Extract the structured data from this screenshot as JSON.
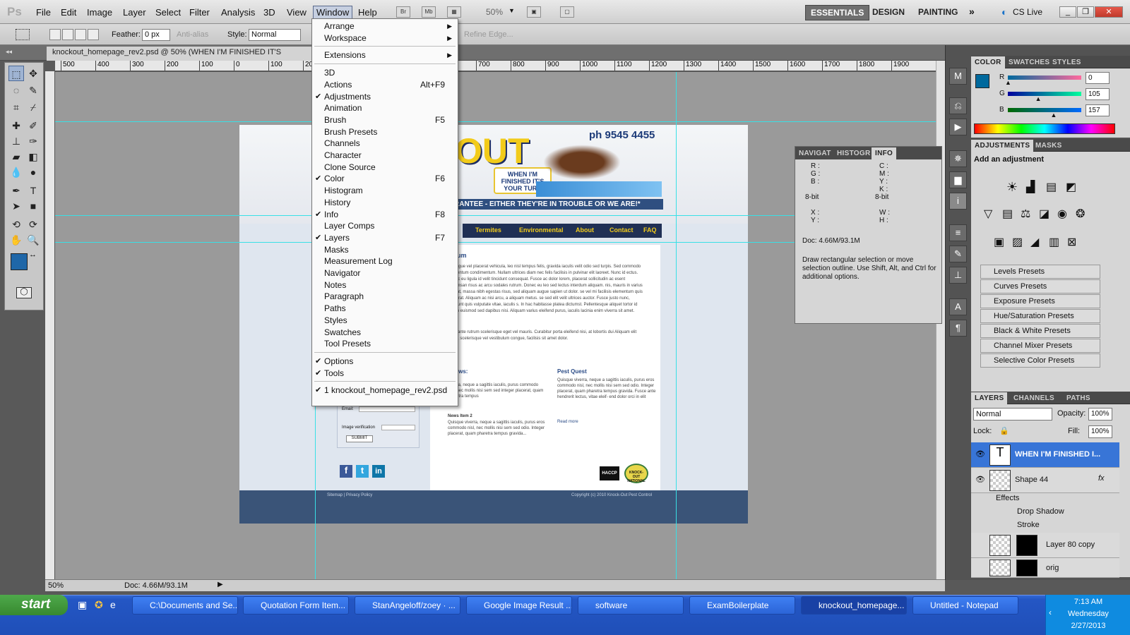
{
  "app": {
    "logo": "Ps"
  },
  "menubar": {
    "items": [
      "File",
      "Edit",
      "Image",
      "Layer",
      "Select",
      "Filter",
      "Analysis",
      "3D",
      "View",
      "Window",
      "Help"
    ],
    "bridge": "Br",
    "minibridge": "Mb",
    "zoom": "50%",
    "workspaces": [
      "ESSENTIALS",
      "DESIGN",
      "PAINTING"
    ],
    "cslive": "CS Live"
  },
  "options": {
    "feather_label": "Feather:",
    "feather_value": "0 px",
    "antialias": "Anti-alias",
    "style_label": "Style:",
    "style_value": "Normal",
    "refine_edge": "Refine Edge..."
  },
  "document": {
    "title": "knockout_homepage_rev2.psd @ 50% (WHEN I'M FINISHED IT'S",
    "zoom": "50%",
    "doc_size": "Doc: 4.66M/93.1M"
  },
  "ruler_ticks": [
    "500",
    "400",
    "300",
    "200",
    "100",
    "0",
    "100",
    "200",
    "300",
    "400",
    "500",
    "600",
    "700",
    "800",
    "900",
    "1000",
    "1100",
    "1200",
    "1300",
    "1400",
    "1500",
    "1600",
    "1700",
    "1800",
    "1900"
  ],
  "website": {
    "logo_text": "OUT",
    "phone": "ph 9545 4455",
    "tagline_box": "WHEN I'M FINISHED IT'S YOUR TURN",
    "guarantee": "RANTEE - EITHER THEY'RE IN TROUBLE OR WE ARE!*",
    "nav": [
      "Termites",
      "Environmental",
      "About",
      "Contact",
      "FAQ"
    ],
    "heading": "ipsum",
    "body": "m, augue vel placerat vehicula, leo nisl tempus felis, gravida iaculis velit odio sed turpis. Sed commodo elementum condimentum. Nullam ultrices diam nec felis facilisis in pulvinar elit laoreet. Nunc id ectus. Donec eu ligula id velit tincidunt consequat. Fusce ac dolor lorem, placerat sollicitudin ac esent accumsan risus ac arcu sodales rutrum. Donec eu leo sed lectus interdum aliquam. nis, mauris in varius feugiat, massa nibh egestas risus, sed aliquam augue sapien ut dolor. se vel mi facilisis elementum quis non erat. Aliquam ac nisi arcu, a aliquam metus. se sed elit velit ultrices auctor. Fusce justo nunc, tincidunt quis vulputate vitae, iaculis s. In hac habitasse platea dictumst. Pellentesque aliquet tortor id ipsum euismod sed dapibus nisi. Aliquam varius eleifend purus, iaculis lacinia enim viverra sit amet.",
    "body2": "lla in ante rutrum scelerisque eget vel mauris. Curabitur porta eleifend nisi, at lobortis dui Aliquam elit lacus, scelerisque vel vestibulum congue, facilisis sit amet dolor.",
    "news_title": "t News:",
    "news_item1_title": "n 1",
    "news_item1": "viverra, neque a sagittis iaculis, purus commodo nisl, nec mollis nisi sem sed integer placerat, quam pharetra tempus",
    "news_item2_title": "News Item 2",
    "news_item2": "Quisque viverra, neque a sagittis iaculis, purus eros commodo nisl, nec mollis nisi sem sed odio. Integer placerat, quam pharetra tempus gravida...",
    "pest_title": "Pest Quest",
    "pest_text": "Quisque viverra, neque a sagittis iaculis, purus eros commodo nisl, nec mollis nisi sem sed odio. Integer placerat, quam pharetra tempus gravida. Fusce ante hendrerit lectus, vitae eleif- end dolor orci in elit",
    "read_more": "Read more",
    "email_label": "Email:",
    "verify_label": "Image verification",
    "submit": "SUBMIT",
    "footer_links": "Sitemap | Privacy Policy",
    "copyright": "Copyright (c) 2010 Knock-Out Pest Control",
    "badge": "HACCP",
    "badge2": "KNOCK-OUT NATIONAL"
  },
  "window_menu": {
    "items": [
      {
        "label": "Arrange",
        "sub": true
      },
      {
        "label": "Workspace",
        "sub": true
      },
      {
        "sep": true
      },
      {
        "label": "Extensions",
        "sub": true
      },
      {
        "sep": true
      },
      {
        "label": "3D"
      },
      {
        "label": "Actions",
        "shortcut": "Alt+F9"
      },
      {
        "label": "Adjustments",
        "checked": true
      },
      {
        "label": "Animation"
      },
      {
        "label": "Brush",
        "shortcut": "F5"
      },
      {
        "label": "Brush Presets"
      },
      {
        "label": "Channels"
      },
      {
        "label": "Character"
      },
      {
        "label": "Clone Source"
      },
      {
        "label": "Color",
        "checked": true,
        "shortcut": "F6"
      },
      {
        "label": "Histogram"
      },
      {
        "label": "History"
      },
      {
        "label": "Info",
        "checked": true,
        "shortcut": "F8"
      },
      {
        "label": "Layer Comps"
      },
      {
        "label": "Layers",
        "checked": true,
        "shortcut": "F7"
      },
      {
        "label": "Masks"
      },
      {
        "label": "Measurement Log"
      },
      {
        "label": "Navigator"
      },
      {
        "label": "Notes"
      },
      {
        "label": "Paragraph"
      },
      {
        "label": "Paths"
      },
      {
        "label": "Styles"
      },
      {
        "label": "Swatches"
      },
      {
        "label": "Tool Presets"
      },
      {
        "sep": true
      },
      {
        "label": "Options",
        "checked": true
      },
      {
        "label": "Tools",
        "checked": true
      },
      {
        "sep": true
      },
      {
        "label": "1 knockout_homepage_rev2.psd",
        "checked": true
      }
    ]
  },
  "info_panel": {
    "tabs": [
      "NAVIGAT",
      "HISTOGR",
      "INFO"
    ],
    "rgb": [
      "R :",
      "G :",
      "B :"
    ],
    "bit1": "8-bit",
    "cmyk": [
      "C :",
      "M :",
      "Y :",
      "K :"
    ],
    "bit2": "8-bit",
    "xy": [
      "X :",
      "Y :"
    ],
    "wh": [
      "W :",
      "H :"
    ],
    "doc": "Doc: 4.66M/93.1M",
    "hint": "Draw rectangular selection or move selection outline.  Use Shift, Alt, and Ctrl for additional options."
  },
  "color_panel": {
    "tabs": [
      "COLOR",
      "SWATCHES",
      "STYLES"
    ],
    "r_label": "R",
    "r": "0",
    "g_label": "G",
    "g": "105",
    "b_label": "B",
    "b": "157",
    "r_level": 0,
    "g_level": 0.41,
    "b_level": 0.62,
    "fg_color": "#00699d"
  },
  "adjustments_panel": {
    "tabs": [
      "ADJUSTMENTS",
      "MASKS"
    ],
    "heading": "Add an adjustment",
    "presets": [
      "Levels Presets",
      "Curves Presets",
      "Exposure Presets",
      "Hue/Saturation Presets",
      "Black & White Presets",
      "Channel Mixer Presets",
      "Selective Color Presets"
    ]
  },
  "layers_panel": {
    "tabs": [
      "LAYERS",
      "CHANNELS",
      "PATHS"
    ],
    "blend": "Normal",
    "opacity_label": "Opacity:",
    "opacity": "100%",
    "lock_label": "Lock:",
    "fill_label": "Fill:",
    "fill": "100%",
    "layers": [
      {
        "name": "WHEN I'M FINISHED I..."
      },
      {
        "name": "Shape 44"
      },
      {
        "name": "Effects"
      },
      {
        "name": "Drop Shadow"
      },
      {
        "name": "Stroke"
      },
      {
        "name": "Layer 80 copy"
      },
      {
        "name": "orig"
      }
    ]
  },
  "taskbar": {
    "start": "start",
    "tasks": [
      "C:\\Documents and Se...",
      "Quotation Form Item...",
      "StanAngeloff/zoey · ...",
      "Google Image Result ...",
      "software",
      "ExamBoilerplate",
      "knockout_homepage...",
      "Untitled - Notepad"
    ],
    "time": "7:13 AM",
    "day": "Wednesday",
    "date": "2/27/2013"
  }
}
